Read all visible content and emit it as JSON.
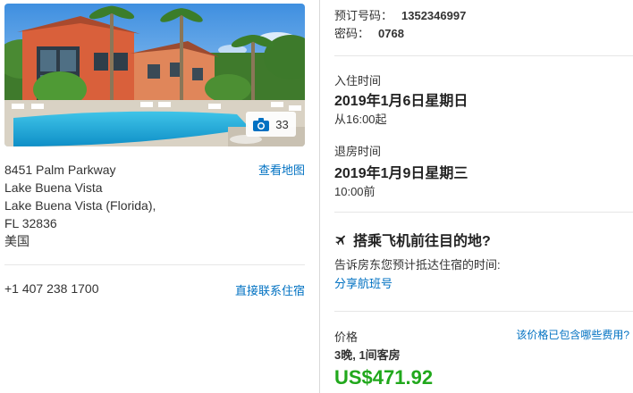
{
  "hotel": {
    "photo_count": "33",
    "address_lines": [
      "8451 Palm Parkway",
      "Lake Buena Vista",
      "Lake Buena Vista (Florida),",
      "FL 32836",
      "美国"
    ],
    "map_link": "查看地图",
    "phone": "+1 407 238 1700",
    "contact_link": "直接联系住宿"
  },
  "booking": {
    "confirmation_label": "预订号码：",
    "confirmation_number": "1352346997",
    "pin_label": "密码：",
    "pin": "0768"
  },
  "checkin": {
    "label": "入住时间",
    "date": "2019年1月6日星期日",
    "time": "从16:00起"
  },
  "checkout": {
    "label": "退房时间",
    "date": "2019年1月9日星期三",
    "time": "10:00前"
  },
  "flight": {
    "title": "搭乘飞机前往目的地?",
    "description": "告诉房东您预计抵达住宿的时间:",
    "share_link": "分享航班号"
  },
  "price": {
    "label": "价格",
    "included_link": "该价格已包含哪些费用?",
    "nights_rooms": "3晚, 1间客房",
    "amount": "US$471.92"
  },
  "colors": {
    "link": "#0071c2",
    "price": "#21a81c"
  }
}
